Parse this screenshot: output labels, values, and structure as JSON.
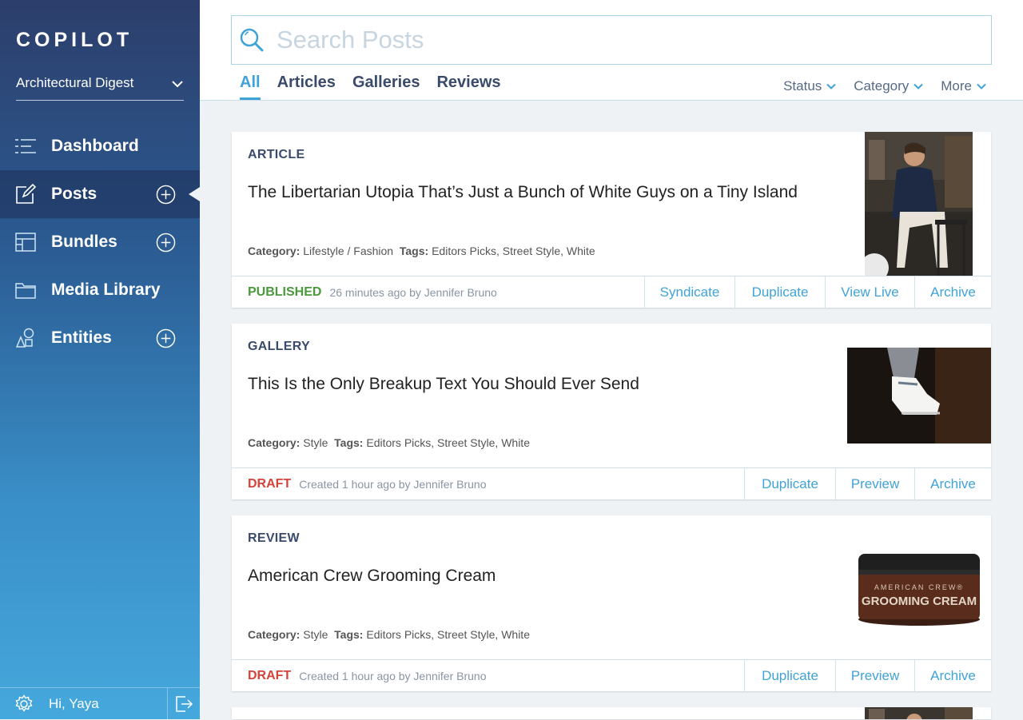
{
  "sidebar": {
    "logo": "COPILOT",
    "brand": "Architectural Digest",
    "nav": [
      {
        "label": "Dashboard"
      },
      {
        "label": "Posts"
      },
      {
        "label": "Bundles"
      },
      {
        "label": "Media Library"
      },
      {
        "label": "Entities"
      }
    ],
    "greeting": "Hi, Yaya"
  },
  "search": {
    "placeholder": "Search Posts"
  },
  "tabs": [
    "All",
    "Articles",
    "Galleries",
    "Reviews"
  ],
  "filters": [
    "Status",
    "Category",
    "More"
  ],
  "cards": [
    {
      "type": "ARTICLE",
      "title": "The Libertarian Utopia That’s Just a Bunch of White Guys on a Tiny Island",
      "category_label": "Category:",
      "category": "Lifestyle / Fashion",
      "tags_label": "Tags:",
      "tags": "Editors Picks, Street Style, White",
      "status": "PUBLISHED",
      "time": "26 minutes ago by Jennifer Bruno",
      "actions": [
        "Syndicate",
        "Duplicate",
        "View Live",
        "Archive"
      ]
    },
    {
      "type": "GALLERY",
      "title": "This Is the Only Breakup Text You Should Ever Send",
      "category_label": "Category:",
      "category": "Style",
      "tags_label": "Tags:",
      "tags": "Editors Picks, Street Style, White",
      "status": "DRAFT",
      "time": "Created 1 hour ago by Jennifer Bruno",
      "actions": [
        "Duplicate",
        "Preview",
        "Archive"
      ]
    },
    {
      "type": "REVIEW",
      "title": "American Crew Grooming Cream",
      "category_label": "Category:",
      "category": "Style",
      "tags_label": "Tags:",
      "tags": "Editors Picks, Street Style, White",
      "status": "DRAFT",
      "time": "Created 1 hour ago by Jennifer Bruno",
      "actions": [
        "Duplicate",
        "Preview",
        "Archive"
      ],
      "jar_text_1": "AMERICAN CREW®",
      "jar_text_2": "GROOMING CREAM"
    }
  ],
  "colors": {
    "accent": "#3fa3d8",
    "published": "#4a9a3c",
    "draft": "#d5433a"
  }
}
